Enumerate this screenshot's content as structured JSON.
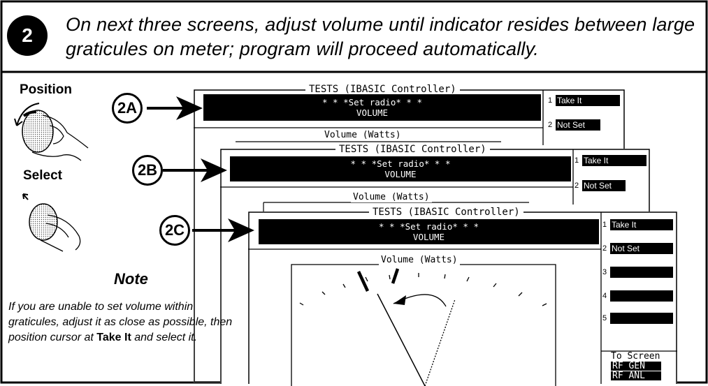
{
  "header": {
    "step_number": "2",
    "instruction": "On next three screens, adjust volume until indicator resides between large graticules on meter; program will proceed automatically."
  },
  "left_panel": {
    "position_label": "Position",
    "select_label": "Select"
  },
  "callouts": [
    "2A",
    "2B",
    "2C"
  ],
  "screen": {
    "title": "TESTS (IBASIC Controller)",
    "prompt_line1": "* * *Set radio* * *",
    "prompt_line2": "VOLUME",
    "meter_title": "Volume (Watts)",
    "softkeys": [
      {
        "num": "1",
        "label": "Take It"
      },
      {
        "num": "2",
        "label": "Not Set"
      },
      {
        "num": "3",
        "label": ""
      },
      {
        "num": "4",
        "label": ""
      },
      {
        "num": "5",
        "label": ""
      }
    ],
    "to_screen_label": "To Screen",
    "to_screen_items": [
      "RF GEN",
      "RF ANL"
    ]
  },
  "note": {
    "title": "Note",
    "body_before": "If you are unable to set volume within graticules, adjust it as close as possible, then position cursor at ",
    "body_bold": "Take It",
    "body_after": "  and select it."
  }
}
